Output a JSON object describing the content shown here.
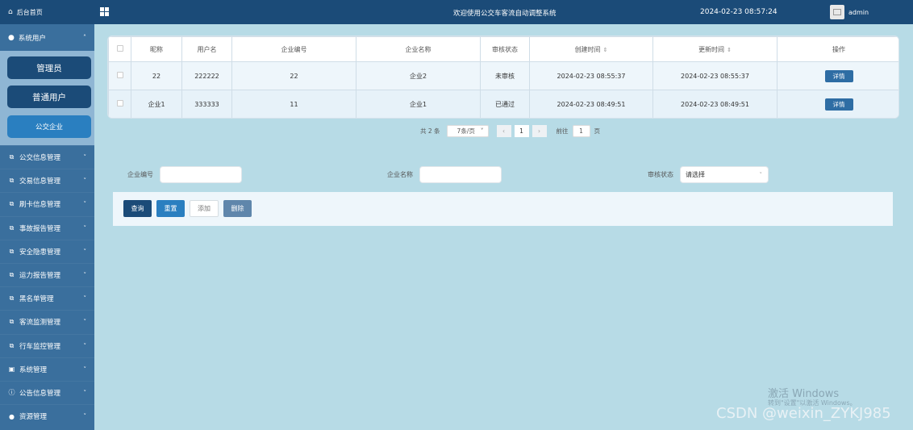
{
  "sidebar": {
    "home": "后台首页",
    "group": "系统用户",
    "sub_items": [
      "管理员",
      "普通用户",
      "公交企业"
    ],
    "menu": [
      {
        "label": "公交信息管理",
        "icon": "external-link-icon"
      },
      {
        "label": "交易信息管理",
        "icon": "external-link-icon"
      },
      {
        "label": "刷卡信息管理",
        "icon": "external-link-icon"
      },
      {
        "label": "事故报告管理",
        "icon": "external-link-icon"
      },
      {
        "label": "安全隐患管理",
        "icon": "external-link-icon"
      },
      {
        "label": "运力报告管理",
        "icon": "external-link-icon"
      },
      {
        "label": "黑名单管理",
        "icon": "external-link-icon"
      },
      {
        "label": "客流监测管理",
        "icon": "external-link-icon"
      },
      {
        "label": "行车监控管理",
        "icon": "external-link-icon"
      },
      {
        "label": "系统管理",
        "icon": "image-icon"
      },
      {
        "label": "公告信息管理",
        "icon": "info-icon"
      },
      {
        "label": "资源管理",
        "icon": "location-icon"
      }
    ]
  },
  "header": {
    "title": "欢迎使用公交车客流自动调整系统",
    "time": "2024-02-23 08:57:24",
    "user": "admin"
  },
  "table": {
    "columns": [
      "昵称",
      "用户名",
      "企业编号",
      "企业名称",
      "审核状态",
      "创建时间",
      "更新时间",
      "操作"
    ],
    "rows": [
      {
        "nickname": "22",
        "username": "222222",
        "code": "22",
        "name": "企业2",
        "status": "未审核",
        "created": "2024-02-23 08:55:37",
        "updated": "2024-02-23 08:55:37",
        "action": "详情"
      },
      {
        "nickname": "企业1",
        "username": "333333",
        "code": "11",
        "name": "企业1",
        "status": "已通过",
        "created": "2024-02-23 08:49:51",
        "updated": "2024-02-23 08:49:51",
        "action": "详情"
      }
    ]
  },
  "pager": {
    "total": "共 2 条",
    "page_size": "7条/页",
    "current_page": "1",
    "goto_label": "前往",
    "goto_value": "1",
    "page_suffix": "页"
  },
  "search": {
    "code_label": "企业编号",
    "name_label": "企业名称",
    "status_label": "审核状态",
    "status_placeholder": "请选择"
  },
  "actions": {
    "query": "查询",
    "reset": "重置",
    "add": "添加",
    "delete": "删除"
  },
  "overlay": {
    "activate_line1": "激活 Windows",
    "activate_line2": "转到\"设置\"以激活 Windows。",
    "credit": "CSDN @weixin_ZYKJ985"
  }
}
